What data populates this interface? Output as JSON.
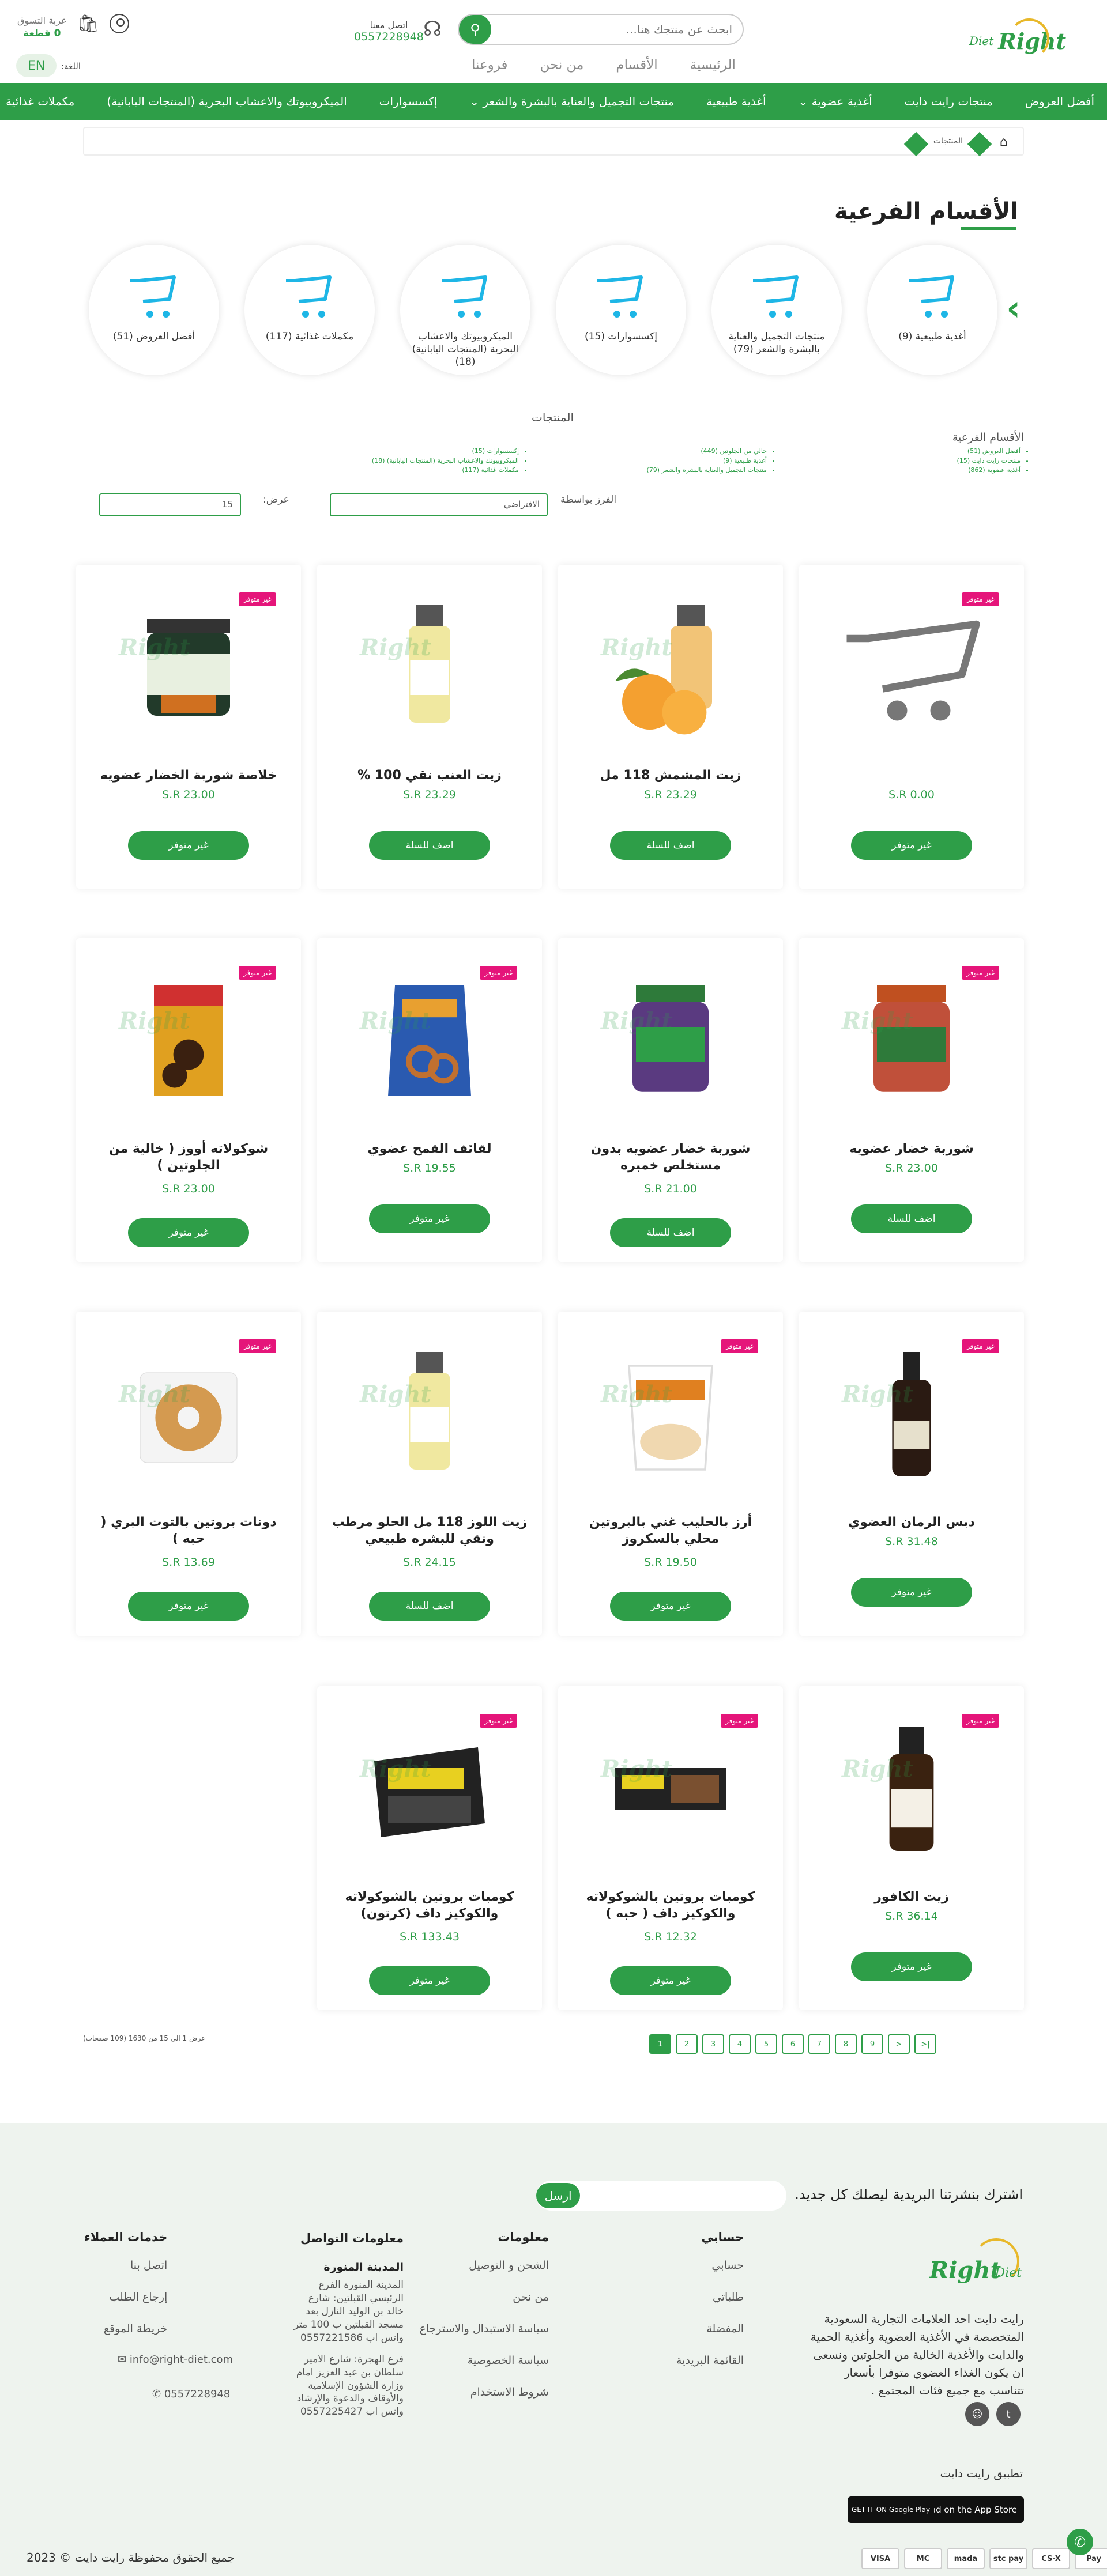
{
  "header": {
    "search_placeholder": "ابحث عن منتجك هنا...",
    "nav": [
      "الرئيسية",
      "الأقسام",
      "من نحن",
      "فروعنا"
    ],
    "phone_label": "اتصل معنا",
    "phone_number": "0557228948",
    "cart_title": "عربة التسوق",
    "cart_count": "0 قطعة",
    "lang_label": "اللغة:",
    "lang_button": "EN",
    "logo_text": "Right",
    "logo_text2": "Diet"
  },
  "main_nav": [
    "أفضل العروض",
    "منتجات رايت دايت",
    "أغذية عضوية",
    "أغذية طبيعية",
    "منتجات التجميل والعناية بالبشرة والشعر",
    "إكسسوارات",
    "الميكروبيوتك والاعشاب البحرية (المنتجات اليابانية)",
    "مكملات غذائية"
  ],
  "breadcrumb": {
    "current": "المنتجات"
  },
  "subcategories": {
    "title": "الأقسام الفرعية",
    "items": [
      "أغذية طبيعية (9)",
      "منتجات التجميل والعناية بالبشرة والشعر (79)",
      "إكسسوارات (15)",
      "الميكروبيوتك والاعشاب البحرية (المنتجات اليابانية) (18)",
      "مكملات غذائية (117)",
      "أفضل العروض (51)"
    ]
  },
  "filters": {
    "products_title": "المنتجات",
    "subcat_label": "الأقسام الفرعية",
    "col1": [
      "أفضل العروض (51)",
      "منتجات رايت دايت (15)",
      "أغذية عضوية (862)"
    ],
    "col2": [
      "خالي من الجلوتين (449)",
      "أغذية طبيعية (9)",
      "منتجات التجميل والعناية بالبشرة والشعر (79)"
    ],
    "col3": [
      "إكسسوارات (15)",
      "الميكروبيوتك والاعشاب البحرية (المنتجات اليابانية) (18)",
      "مكملات غذائية (117)"
    ],
    "sort_label": "الفرز بواسطة",
    "sort_value": "الافتراضي",
    "show_label": "عرض:",
    "show_value": "15"
  },
  "products": [
    {
      "name": "",
      "price": "S.R 0.00",
      "badge": "غير متوفر",
      "button": "غير متوفر"
    },
    {
      "name": "زيت المشمش 118 مل",
      "price": "S.R 23.29",
      "badge": "",
      "button": "اضف للسلة"
    },
    {
      "name": "زيت العنب نقي 100 %",
      "price": "S.R 23.29",
      "badge": "",
      "button": "اضف للسلة"
    },
    {
      "name": "خلاصة شوربة الخضار عضويه",
      "price": "S.R 23.00",
      "badge": "غير متوفر",
      "button": "غير متوفر"
    },
    {
      "name": "شوربة خضار عضويه",
      "price": "S.R 23.00",
      "badge": "غير متوفر",
      "button": "اضف للسلة"
    },
    {
      "name": "شوربة خضار عضويه بدون مستخلص خمبره",
      "price": "S.R 21.00",
      "badge": "",
      "button": "اضف للسلة"
    },
    {
      "name": "لقائف القمح عضوي",
      "price": "S.R 19.55",
      "badge": "غير متوفر",
      "button": "غير متوفر"
    },
    {
      "name": "شوكولاته أووز ( خالية من الجلوتين )",
      "price": "S.R 23.00",
      "badge": "غير متوفر",
      "button": "غير متوفر"
    },
    {
      "name": "دبس الرمان العضوي",
      "price": "S.R 31.48",
      "badge": "غير متوفر",
      "button": "غير متوفر"
    },
    {
      "name": "أرز بالحليب غني بالبروتين محلي بالسكروز",
      "price": "S.R 19.50",
      "badge": "غير متوفر",
      "button": "غير متوفر"
    },
    {
      "name": "زيت اللوز 118 مل الحلو مرطب ونقي للبشره طبيعي",
      "price": "S.R 24.15",
      "badge": "",
      "button": "اضف للسلة"
    },
    {
      "name": "دونات بروتين بالتوت البري ( حبه )",
      "price": "S.R 13.69",
      "badge": "غير متوفر",
      "button": "غير متوفر"
    },
    {
      "name": "زيت الكافور",
      "price": "S.R 36.14",
      "badge": "غير متوفر",
      "button": "غير متوفر"
    },
    {
      "name": "كومبات بروتين بالشوكولاته والكوكيز داف ( حبه )",
      "price": "S.R 12.32",
      "badge": "غير متوفر",
      "button": "غير متوفر"
    },
    {
      "name": "كومبات بروتين بالشوكولاته والكوكيز داف (كرتون)",
      "price": "S.R 133.43",
      "badge": "غير متوفر",
      "button": "غير متوفر"
    }
  ],
  "pagination": {
    "pages": [
      "1",
      "2",
      "3",
      "4",
      "5",
      "6",
      "7",
      "8",
      "9",
      ">",
      ">|"
    ],
    "info": "عرض 1 الى 15 من 1630 (109 صفحات)"
  },
  "footer": {
    "newsletter_text": "اشترك بنشرتنا البريدية ليصلك كل جديد.",
    "newsletter_button": "ارسل",
    "about": "رايت دايت احد العلامات التجارية السعودية المتخصصة في الأغذية العضوية وأغذية الحمية والدايت والأغذية الخالية من الجلوتين ونسعى ان يكون الغذاء العضوي متوفرا بأسعار تتناسب مع جميع فئات المجتمع .",
    "account": {
      "title": "حسابي",
      "items": [
        "حسابي",
        "طلباتي",
        "المفضلة",
        "القائمة البريدية"
      ]
    },
    "info": {
      "title": "معلومات",
      "items": [
        "الشحن و التوصيل",
        "من نحن",
        "سياسة الاستبدال والاسترجاع",
        "سياسة الخصوصية",
        "شروط الاستخدام"
      ]
    },
    "contact": {
      "title": "معلومات التواصل",
      "city": "المدينة المنورة",
      "branch1": "المدينة المنورة الفرع الرئيسي القبلتين: شارع خالد بن الوليد النازل بعد مسجد القبلتين ب 100 متر واتس اب 0557221586",
      "branch2": "فرع الهجرة: شارع الامير سلطان بن عبد العزيز امام وزارة الشؤون الإسلامية والأوقاف والدعوة والإرشاد واتس اب 0557225427",
      "email": "info@right-diet.com",
      "phone": "0557228948"
    },
    "service": {
      "title": "خدمات العملاء",
      "items": [
        "اتصل بنا",
        "إرجاع الطلب",
        "خريطة الموقع"
      ]
    },
    "app_label": "تطبيق رايت دايت",
    "google_play": "GET IT ON Google Play",
    "app_store": "Download on the App Store",
    "copyright": "جميع الحقوق محفوظة رايت دايت © 2023",
    "payments": [
      "Pay",
      "CS-X",
      "stc pay",
      "mada",
      "MC",
      "VISA"
    ]
  },
  "colors": {
    "brand": "#2e9e48",
    "badge": "#e5157a",
    "accent": "#e8b829"
  }
}
